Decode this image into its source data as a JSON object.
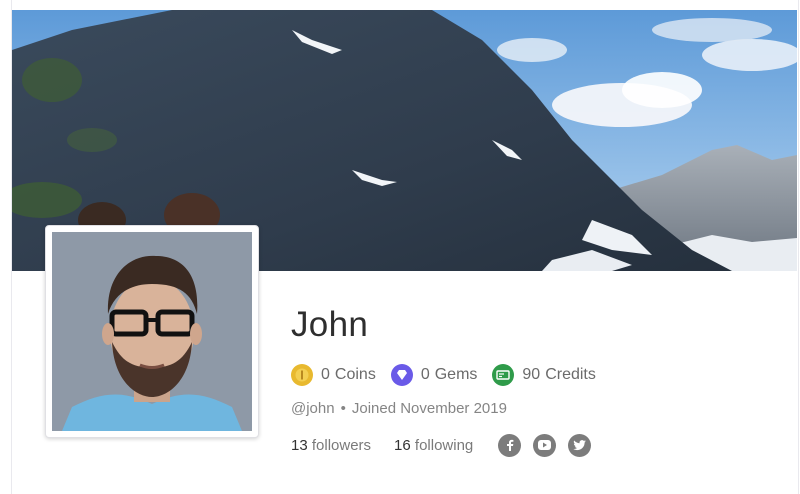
{
  "profile": {
    "name": "John",
    "handle": "@john",
    "separator": "•",
    "joined": "Joined November 2019"
  },
  "stats": [
    {
      "icon": "coin-icon",
      "value": "0",
      "label": "Coins",
      "color": "#e8b92f"
    },
    {
      "icon": "gem-icon",
      "value": "0",
      "label": "Gems",
      "color": "#6a5ae8"
    },
    {
      "icon": "credits-icon",
      "value": "90",
      "label": "Credits",
      "color": "#2f9b4a"
    }
  ],
  "follow": {
    "followers_count": "13",
    "followers_label": "followers",
    "following_count": "16",
    "following_label": "following"
  },
  "social": [
    {
      "icon": "facebook-icon",
      "glyph": "f"
    },
    {
      "icon": "youtube-icon",
      "glyph": "▶"
    },
    {
      "icon": "twitter-icon",
      "glyph": "🐦"
    }
  ],
  "colors": {
    "sky": "#8fbde6",
    "mountain": "#4b5a6e",
    "avatar_bg": "#8d99a8",
    "shirt": "#6fb6df",
    "social_bg": "#7c7c7c"
  }
}
